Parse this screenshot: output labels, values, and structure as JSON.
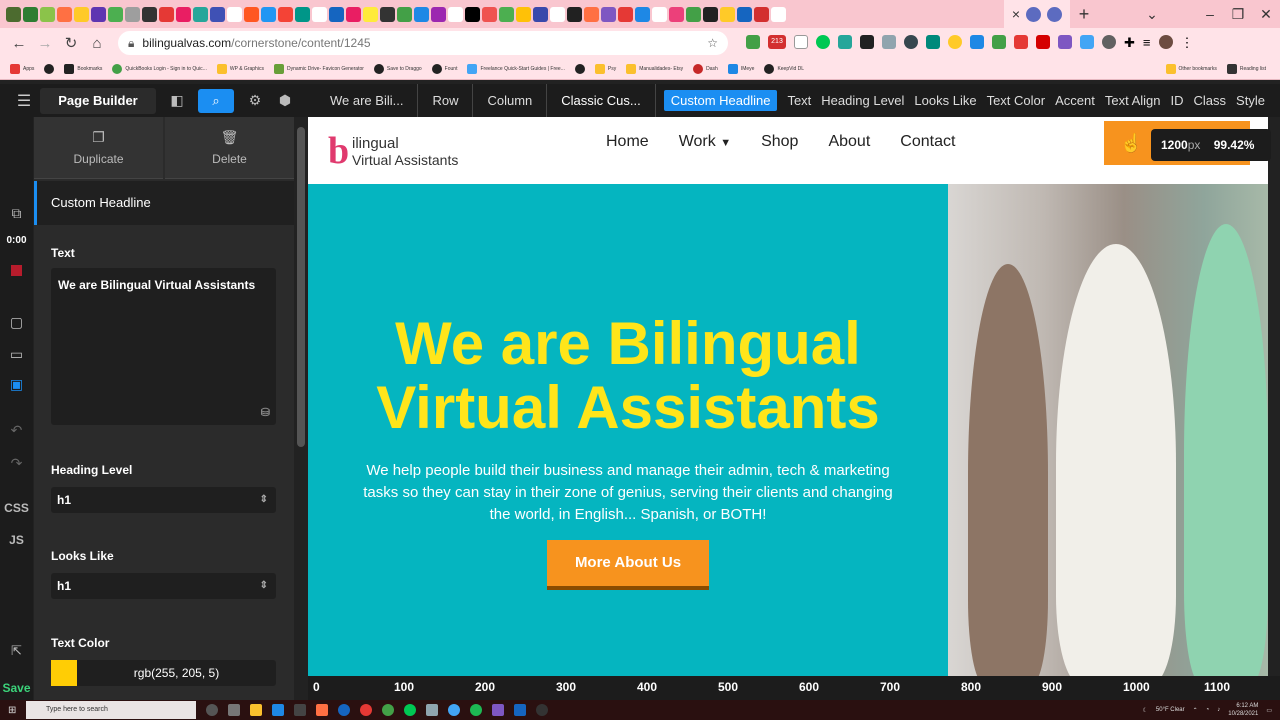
{
  "browser": {
    "close_tab": "×",
    "new_tab": "+",
    "url_host": "bilingualvas.com",
    "url_path": "/cornerstone/content/1245",
    "bookmarks": [
      "Apps",
      "Bookmarks",
      "QuickBooks Login - Sign in to Quic...",
      "WP & Graphics",
      "Dynamic Drive- Favicon Generator",
      "Save to Draggo",
      "Fount",
      "Freelance Quick-Start Guides | Free...",
      "Psy",
      "Manualidades- Etsy",
      "Dash",
      "IMeye",
      "KeepVid DL"
    ],
    "other_bookmarks": "Other bookmarks",
    "reading_list": "Reading list",
    "ext_badge": "213"
  },
  "builder": {
    "title": "Page Builder",
    "breadcrumbs": [
      "We are Bili...",
      "Row",
      "Column",
      "Classic Cus..."
    ],
    "active_element": "Custom Headline",
    "properties": [
      "Text",
      "Heading Level",
      "Looks Like",
      "Text Color",
      "Accent",
      "Text Align",
      "ID",
      "Class",
      "Style"
    ],
    "timer": "0:00",
    "css_label": "CSS",
    "js_label": "JS",
    "save_label": "Save"
  },
  "panel": {
    "duplicate": "Duplicate",
    "delete": "Delete",
    "element_title": "Custom Headline",
    "text_label": "Text",
    "text_value": "We are Bilingual Virtual Assistants",
    "heading_level_label": "Heading Level",
    "heading_level_value": "h1",
    "looks_like_label": "Looks Like",
    "looks_like_value": "h1",
    "text_color_label": "Text Color",
    "text_color_value": "rgb(255, 205, 5)",
    "text_color_hex": "#ffcd05"
  },
  "site": {
    "logo_line1": "ilingual",
    "logo_line2": "Virtual Assistants",
    "nav": [
      "Home",
      "Work",
      "Shop",
      "About",
      "Contact"
    ],
    "hero_heading": "We are Bilingual Virtual Assistants",
    "hero_text": "We help people build their business and manage their admin, tech & marketing tasks so they can stay in their zone of genius, serving their clients and changing the world, in  English... Spanish, or BOTH!",
    "hero_button": "More About Us",
    "hero_bg_color": "#05b5c0",
    "accent_color": "#f7931e"
  },
  "viewport": {
    "width": "1200",
    "unit": "px",
    "zoom": "99.42%"
  },
  "ruler": [
    "0",
    "100",
    "200",
    "300",
    "400",
    "500",
    "600",
    "700",
    "800",
    "900",
    "1000",
    "1100"
  ],
  "taskbar": {
    "search_placeholder": "Type here to search",
    "weather": "50°F  Clear",
    "time": "6:12 AM",
    "date": "10/28/2021"
  }
}
